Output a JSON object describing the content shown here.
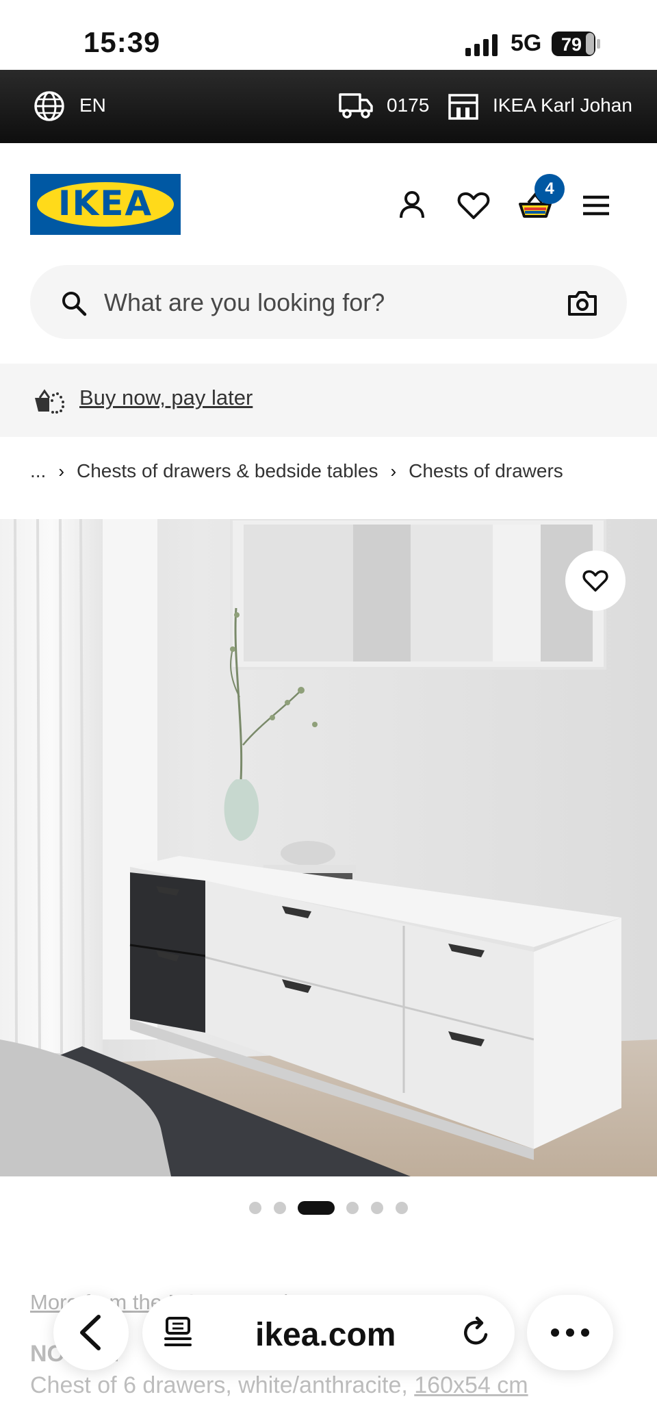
{
  "status_bar": {
    "time": "15:39",
    "network": "5G",
    "battery": "79"
  },
  "top_bar": {
    "language": "EN",
    "postcode": "0175",
    "store": "IKEA Karl Johan"
  },
  "header": {
    "logo_text": "IKEA",
    "cart_count": "4",
    "icons": [
      "user-icon",
      "heart-icon",
      "cart-icon",
      "menu-icon"
    ]
  },
  "search": {
    "placeholder": "What are you looking for?"
  },
  "promo": {
    "link": "Buy now, pay later"
  },
  "breadcrumb": {
    "ellipsis": "...",
    "items": [
      "Chests of drawers & bedside tables",
      "Chests of drawers"
    ]
  },
  "gallery": {
    "image_count": 6,
    "active_index": 3
  },
  "product": {
    "more_link": "More from the NORDLI series",
    "name": "NORDLI",
    "description": "Chest of 6 drawers, white/anthracite, ",
    "size": "160x54 cm"
  },
  "browser": {
    "url": "ikea.com"
  },
  "colors": {
    "ikea_blue": "#0058a3",
    "ikea_yellow": "#ffda1a"
  }
}
